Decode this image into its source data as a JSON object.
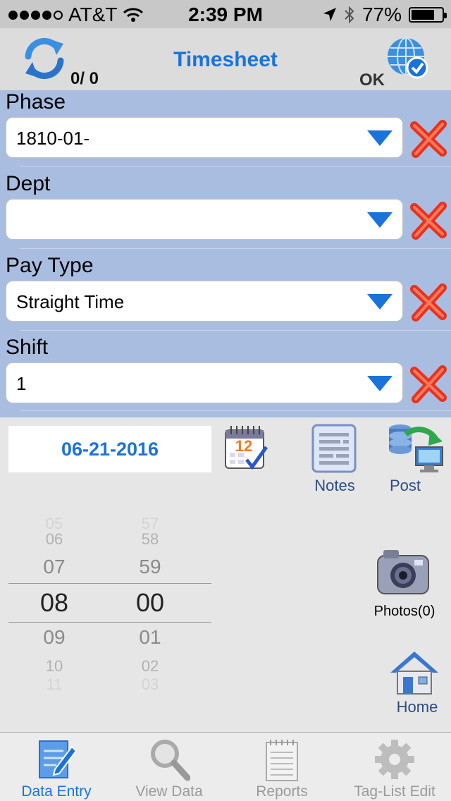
{
  "status_bar": {
    "carrier": "AT&T",
    "time": "2:39 PM",
    "battery": "77%",
    "battery_level": 0.77
  },
  "header": {
    "title": "Timesheet",
    "counter": "0/  0",
    "ok_label": "OK"
  },
  "fields": [
    {
      "label": "Phase",
      "value": "1810-01-"
    },
    {
      "label": "Dept",
      "value": ""
    },
    {
      "label": "Pay Type",
      "value": "Straight Time"
    },
    {
      "label": "Shift",
      "value": "1"
    }
  ],
  "date": "06-21-2016",
  "notes_label": "Notes",
  "post_label": "Post",
  "photos_label": "Photos(0)",
  "home_label": "Home",
  "time_picker": {
    "hours": [
      "05",
      "06",
      "07",
      "08",
      "09",
      "10",
      "11"
    ],
    "minutes": [
      "57",
      "58",
      "59",
      "00",
      "01",
      "02",
      "03"
    ]
  },
  "tabs": [
    {
      "label": "Data Entry",
      "active": true
    },
    {
      "label": "View Data",
      "active": false
    },
    {
      "label": "Reports",
      "active": false
    },
    {
      "label": "Tag-List Edit",
      "active": false
    }
  ],
  "colors": {
    "accent": "#1a73d9",
    "panel": "#a9bde0",
    "clear": "#e8321e"
  }
}
